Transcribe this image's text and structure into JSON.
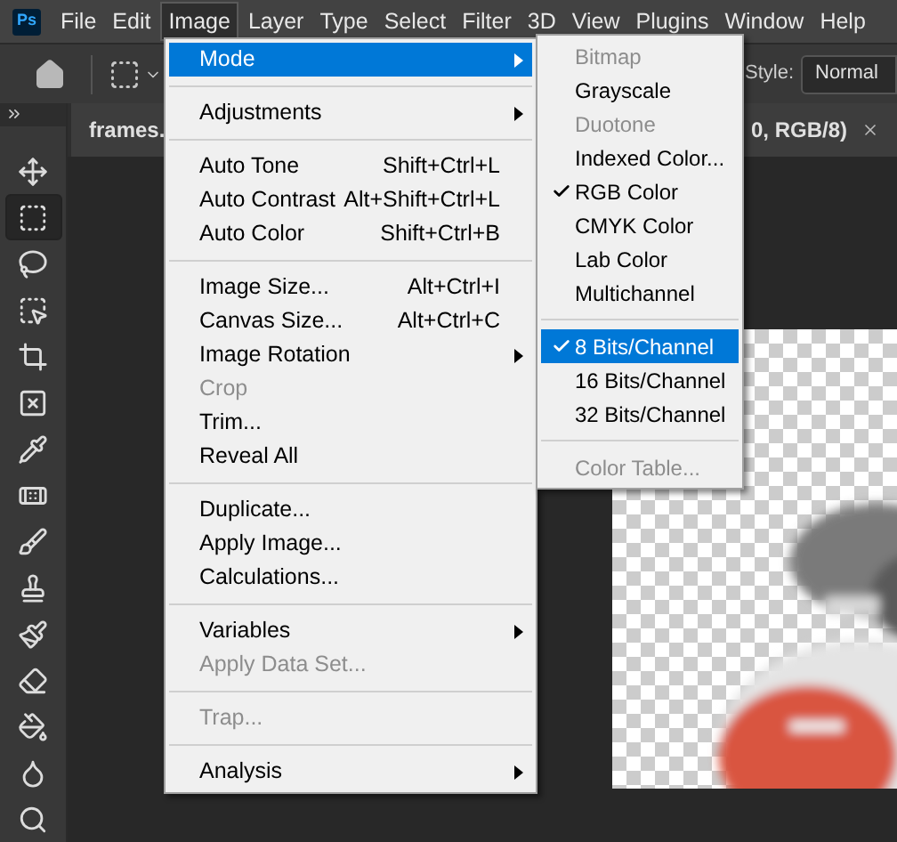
{
  "logo": "Ps",
  "menubar": [
    {
      "label": "File",
      "selected": false
    },
    {
      "label": "Edit",
      "selected": false
    },
    {
      "label": "Image",
      "selected": true
    },
    {
      "label": "Layer",
      "selected": false
    },
    {
      "label": "Type",
      "selected": false
    },
    {
      "label": "Select",
      "selected": false
    },
    {
      "label": "Filter",
      "selected": false
    },
    {
      "label": "3D",
      "selected": false
    },
    {
      "label": "View",
      "selected": false
    },
    {
      "label": "Plugins",
      "selected": false
    },
    {
      "label": "Window",
      "selected": false
    },
    {
      "label": "Help",
      "selected": false
    }
  ],
  "options_bar": {
    "style_label": "Style:",
    "style_value": "Normal"
  },
  "document_tab": {
    "title_start": "frames.",
    "title_end": "0, RGB/8)"
  },
  "tools": [
    {
      "kind": "move",
      "selected": false
    },
    {
      "kind": "marquee",
      "selected": true
    },
    {
      "kind": "lasso",
      "selected": false
    },
    {
      "kind": "object-select",
      "selected": false
    },
    {
      "kind": "crop",
      "selected": false
    },
    {
      "kind": "frame",
      "selected": false
    },
    {
      "kind": "eyedropper",
      "selected": false
    },
    {
      "kind": "healing",
      "selected": false
    },
    {
      "kind": "brush",
      "selected": false
    },
    {
      "kind": "stamp",
      "selected": false
    },
    {
      "kind": "history-brush",
      "selected": false
    },
    {
      "kind": "eraser",
      "selected": false
    },
    {
      "kind": "bucket",
      "selected": false
    },
    {
      "kind": "blur",
      "selected": false
    },
    {
      "kind": "zoom",
      "selected": false
    }
  ],
  "image_menu": [
    {
      "kind": "item",
      "label": "Mode",
      "submenu": true,
      "disabled": false,
      "selected": true
    },
    {
      "kind": "separator"
    },
    {
      "kind": "item",
      "label": "Adjustments",
      "submenu": true,
      "disabled": false,
      "selected": false
    },
    {
      "kind": "separator"
    },
    {
      "kind": "item",
      "label": "Auto Tone",
      "shortcut": "Shift+Ctrl+L",
      "submenu": false,
      "disabled": false,
      "selected": false
    },
    {
      "kind": "item",
      "label": "Auto Contrast",
      "shortcut": "Alt+Shift+Ctrl+L",
      "submenu": false,
      "disabled": false,
      "selected": false
    },
    {
      "kind": "item",
      "label": "Auto Color",
      "shortcut": "Shift+Ctrl+B",
      "submenu": false,
      "disabled": false,
      "selected": false
    },
    {
      "kind": "separator"
    },
    {
      "kind": "item",
      "label": "Image Size...",
      "shortcut": "Alt+Ctrl+I",
      "submenu": false,
      "disabled": false,
      "selected": false
    },
    {
      "kind": "item",
      "label": "Canvas Size...",
      "shortcut": "Alt+Ctrl+C",
      "submenu": false,
      "disabled": false,
      "selected": false
    },
    {
      "kind": "item",
      "label": "Image Rotation",
      "submenu": true,
      "disabled": false,
      "selected": false
    },
    {
      "kind": "item",
      "label": "Crop",
      "submenu": false,
      "disabled": true,
      "selected": false
    },
    {
      "kind": "item",
      "label": "Trim...",
      "submenu": false,
      "disabled": false,
      "selected": false
    },
    {
      "kind": "item",
      "label": "Reveal All",
      "submenu": false,
      "disabled": false,
      "selected": false
    },
    {
      "kind": "separator"
    },
    {
      "kind": "item",
      "label": "Duplicate...",
      "submenu": false,
      "disabled": false,
      "selected": false
    },
    {
      "kind": "item",
      "label": "Apply Image...",
      "submenu": false,
      "disabled": false,
      "selected": false
    },
    {
      "kind": "item",
      "label": "Calculations...",
      "submenu": false,
      "disabled": false,
      "selected": false
    },
    {
      "kind": "separator"
    },
    {
      "kind": "item",
      "label": "Variables",
      "submenu": true,
      "disabled": false,
      "selected": false
    },
    {
      "kind": "item",
      "label": "Apply Data Set...",
      "submenu": false,
      "disabled": true,
      "selected": false
    },
    {
      "kind": "separator"
    },
    {
      "kind": "item",
      "label": "Trap...",
      "submenu": false,
      "disabled": true,
      "selected": false
    },
    {
      "kind": "separator"
    },
    {
      "kind": "item",
      "label": "Analysis",
      "submenu": true,
      "disabled": false,
      "selected": false
    }
  ],
  "mode_submenu": [
    {
      "kind": "item",
      "label": "Bitmap",
      "checked": false,
      "disabled": true,
      "selected": false
    },
    {
      "kind": "item",
      "label": "Grayscale",
      "checked": false,
      "disabled": false,
      "selected": false
    },
    {
      "kind": "item",
      "label": "Duotone",
      "checked": false,
      "disabled": true,
      "selected": false
    },
    {
      "kind": "item",
      "label": "Indexed Color...",
      "checked": false,
      "disabled": false,
      "selected": false
    },
    {
      "kind": "item",
      "label": "RGB Color",
      "checked": true,
      "disabled": false,
      "selected": false
    },
    {
      "kind": "item",
      "label": "CMYK Color",
      "checked": false,
      "disabled": false,
      "selected": false
    },
    {
      "kind": "item",
      "label": "Lab Color",
      "checked": false,
      "disabled": false,
      "selected": false
    },
    {
      "kind": "item",
      "label": "Multichannel",
      "checked": false,
      "disabled": false,
      "selected": false
    },
    {
      "kind": "separator"
    },
    {
      "kind": "item",
      "label": "8 Bits/Channel",
      "checked": true,
      "disabled": false,
      "selected": true
    },
    {
      "kind": "item",
      "label": "16 Bits/Channel",
      "checked": false,
      "disabled": false,
      "selected": false
    },
    {
      "kind": "item",
      "label": "32 Bits/Channel",
      "checked": false,
      "disabled": false,
      "selected": false
    },
    {
      "kind": "separator"
    },
    {
      "kind": "item",
      "label": "Color Table...",
      "checked": false,
      "disabled": true,
      "selected": false
    }
  ]
}
